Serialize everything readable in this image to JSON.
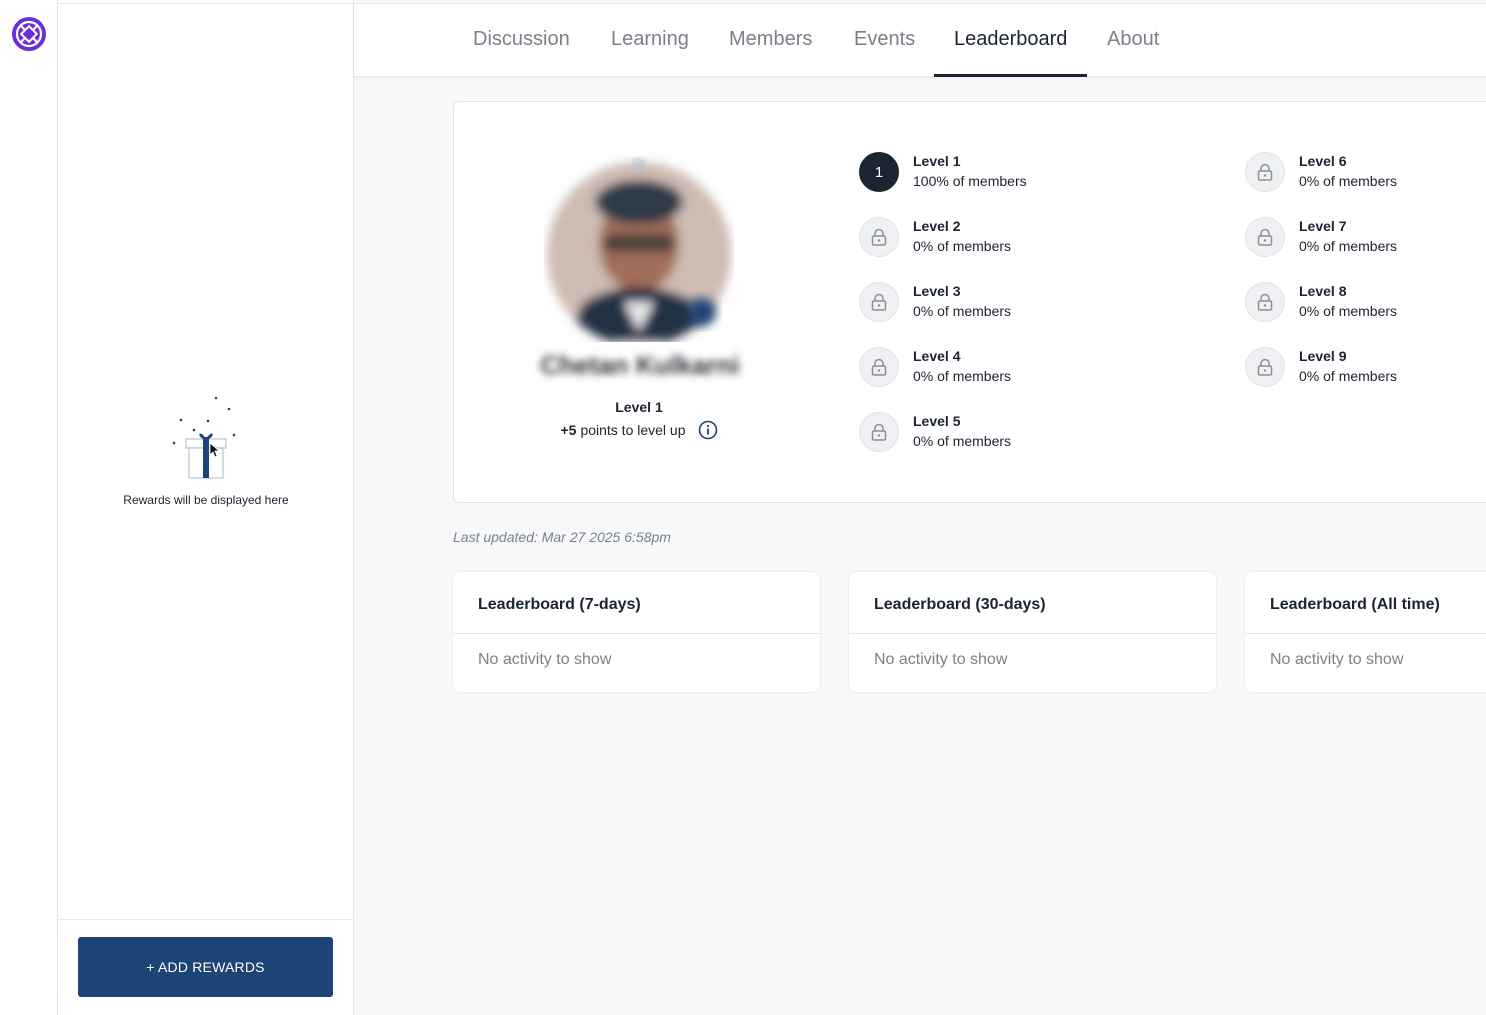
{
  "nav": {
    "tabs": [
      {
        "label": "Discussion"
      },
      {
        "label": "Learning"
      },
      {
        "label": "Members"
      },
      {
        "label": "Events"
      },
      {
        "label": "Leaderboard"
      },
      {
        "label": "About"
      }
    ],
    "active_tab": "Leaderboard"
  },
  "rewards": {
    "empty_text": "Rewards will be displayed here",
    "add_button": "+ ADD REWARDS"
  },
  "profile": {
    "name": "Chetan Kulkarni",
    "level_label": "Level 1",
    "points": "+5",
    "points_text": "points to level up"
  },
  "levels": [
    {
      "badge": "1",
      "name": "Level 1",
      "pct": "100% of members",
      "state": "current"
    },
    {
      "badge": "lock-icon",
      "name": "Level 2",
      "pct": "0% of members",
      "state": "locked"
    },
    {
      "badge": "lock-icon",
      "name": "Level 3",
      "pct": "0% of members",
      "state": "locked"
    },
    {
      "badge": "lock-icon",
      "name": "Level 4",
      "pct": "0% of members",
      "state": "locked"
    },
    {
      "badge": "lock-icon",
      "name": "Level 5",
      "pct": "0% of members",
      "state": "locked"
    },
    {
      "badge": "lock-icon",
      "name": "Level 6",
      "pct": "0% of members",
      "state": "locked"
    },
    {
      "badge": "lock-icon",
      "name": "Level 7",
      "pct": "0% of members",
      "state": "locked"
    },
    {
      "badge": "lock-icon",
      "name": "Level 8",
      "pct": "0% of members",
      "state": "locked"
    },
    {
      "badge": "lock-icon",
      "name": "Level 9",
      "pct": "0% of members",
      "state": "locked"
    }
  ],
  "last_updated": "Last updated: Mar 27 2025 6:58pm",
  "leaderboards": [
    {
      "title": "Leaderboard (7-days)",
      "empty": "No activity to show"
    },
    {
      "title": "Leaderboard (30-days)",
      "empty": "No activity to show"
    },
    {
      "title": "Leaderboard (All time)",
      "empty": "No activity to show"
    }
  ],
  "colors": {
    "primary": "#1d4477",
    "dark": "#1b2431",
    "brand": "#6b2fd6",
    "muted": "#7b8189"
  }
}
